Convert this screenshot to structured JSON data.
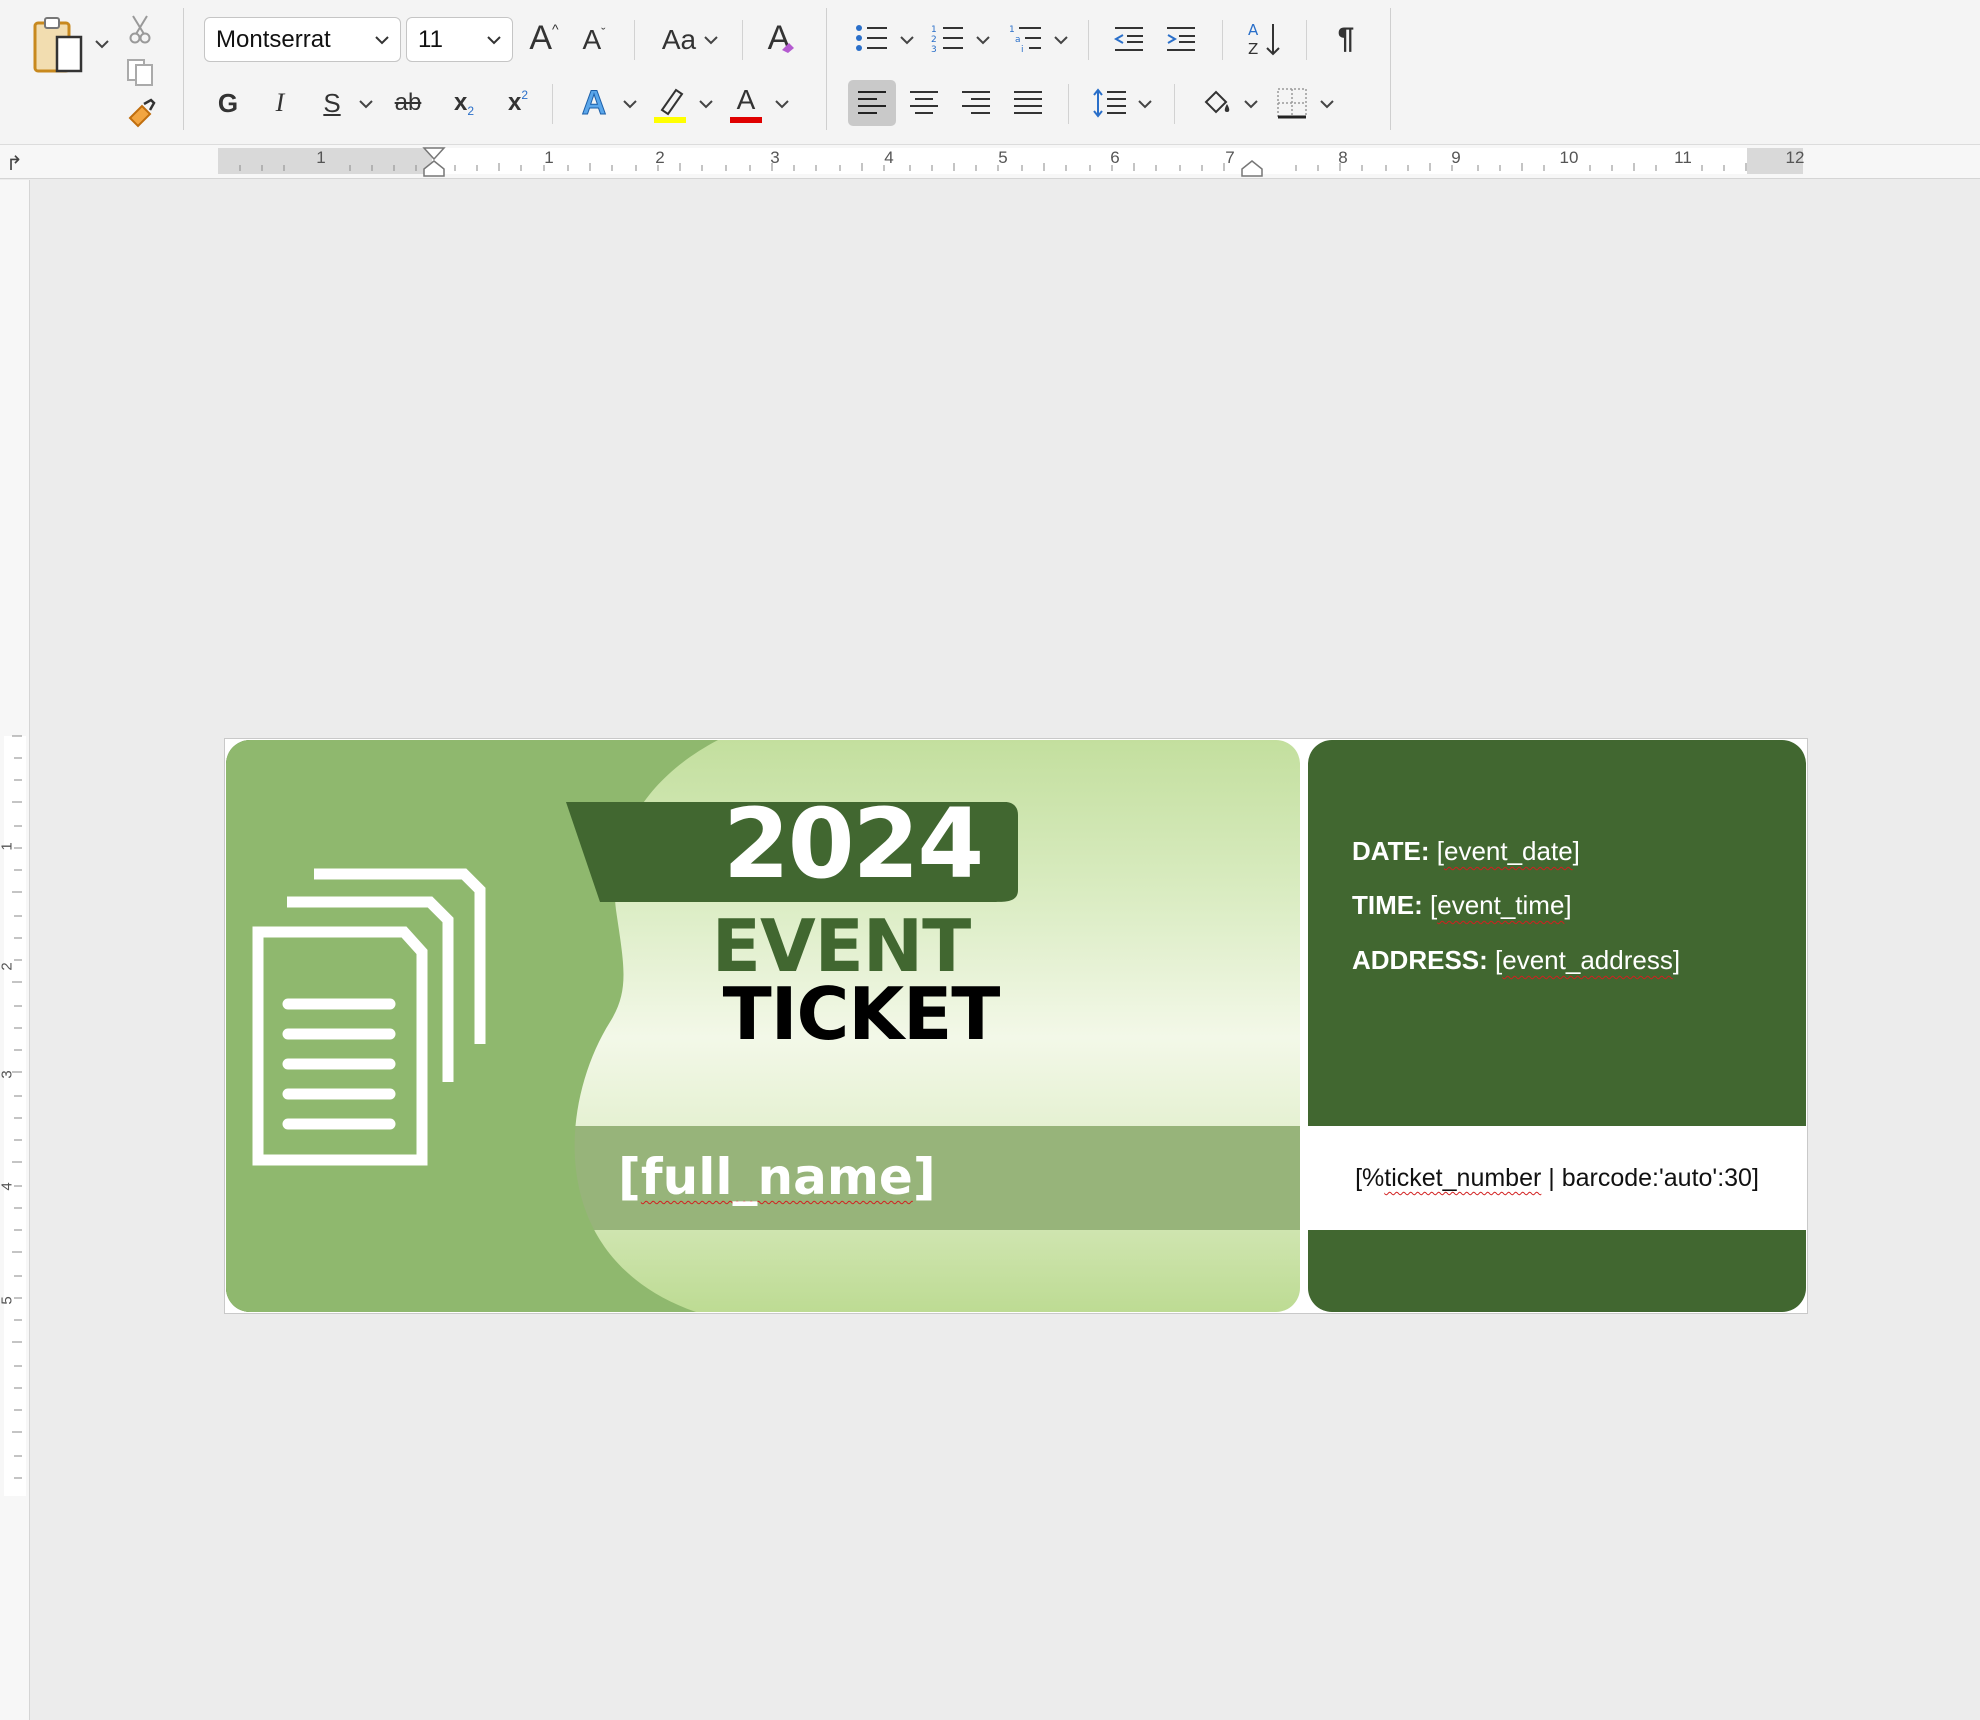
{
  "toolbar": {
    "font_name": "Montserrat",
    "font_size": "11",
    "bold_label": "G",
    "italic_label": "I",
    "underline_label": "S",
    "strike_label": "ab",
    "subscript_label": "x",
    "subscript_mark": "2",
    "superscript_label": "x",
    "superscript_mark": "2",
    "case_label": "Aa",
    "grow_label": "A",
    "shrink_label": "A",
    "text_effects_label": "A",
    "font_color_label": "A",
    "clear_format_label": "A",
    "pilcrow": "¶",
    "highlight_color": "#ffff00",
    "font_color": "#e00000"
  },
  "ruler": {
    "numbers": [
      "1",
      "1",
      "2",
      "3",
      "4",
      "5",
      "6",
      "7",
      "8",
      "9",
      "10",
      "11",
      "12"
    ],
    "vnumbers": [
      "1",
      "2",
      "3",
      "4",
      "5"
    ]
  },
  "ticket": {
    "year": "2024",
    "title_line1": "EVENT",
    "title_line2": "TICKET",
    "name_placeholder_open": "[",
    "name_placeholder_word": "full_name",
    "name_placeholder_close": "]",
    "date_label": "DATE:",
    "date_open": "[",
    "date_value": "event_date",
    "date_close": "]",
    "time_label": "TIME:",
    "time_open": "[",
    "time_value": "event_time",
    "time_close": "]",
    "address_label": "ADDRESS:",
    "address_open": "[",
    "address_value": "event_address",
    "address_close": "]",
    "barcode_open": "[%",
    "barcode_word": "ticket_number",
    "barcode_rest": " | barcode:'auto':30]",
    "colors": {
      "dark_green": "#416730",
      "mid_green": "#97b47a",
      "light_green": "#c3df9e"
    }
  }
}
